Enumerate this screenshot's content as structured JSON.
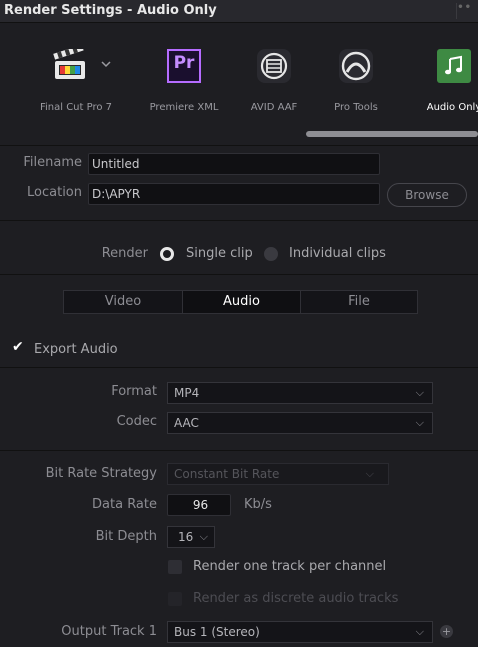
{
  "window": {
    "title": "Render Settings - Audio Only",
    "menu_glyph": "••"
  },
  "presets": [
    {
      "label": "Final Cut Pro 7",
      "icon": "clapperboard-icon"
    },
    {
      "label": "Premiere XML",
      "icon": "premiere-icon",
      "icon_text": "Pr"
    },
    {
      "label": "AVID AAF",
      "icon": "avid-icon"
    },
    {
      "label": "Pro Tools",
      "icon": "pro-tools-icon"
    },
    {
      "label": "Audio Only",
      "icon": "music-note-icon",
      "selected": true
    }
  ],
  "file": {
    "filename_label": "Filename",
    "filename_value": "Untitled",
    "location_label": "Location",
    "location_value": "D:\\APYR",
    "browse_label": "Browse"
  },
  "render": {
    "label": "Render",
    "single_clip": "Single clip",
    "individual_clips": "Individual clips",
    "selected": "single_clip"
  },
  "tabs": [
    "Video",
    "Audio",
    "File"
  ],
  "active_tab": "Audio",
  "export_audio": {
    "label": "Export Audio",
    "checked": true
  },
  "format": {
    "label": "Format",
    "value": "MP4"
  },
  "codec": {
    "label": "Codec",
    "value": "AAC"
  },
  "bitrate": {
    "strategy_label": "Bit Rate Strategy",
    "strategy_value": "Constant Bit Rate",
    "data_rate_label": "Data Rate",
    "data_rate_value": "96",
    "data_rate_unit": "Kb/s",
    "bit_depth_label": "Bit Depth",
    "bit_depth_value": "16"
  },
  "options": {
    "one_track_per_channel": "Render one track per channel",
    "discrete_audio_tracks": "Render as discrete audio tracks"
  },
  "output_track": {
    "label": "Output Track 1",
    "value": "Bus 1 (Stereo)"
  },
  "colors": {
    "background": "#1e1e22",
    "selected_text": "#ffffff",
    "field_bg": "#101013"
  }
}
